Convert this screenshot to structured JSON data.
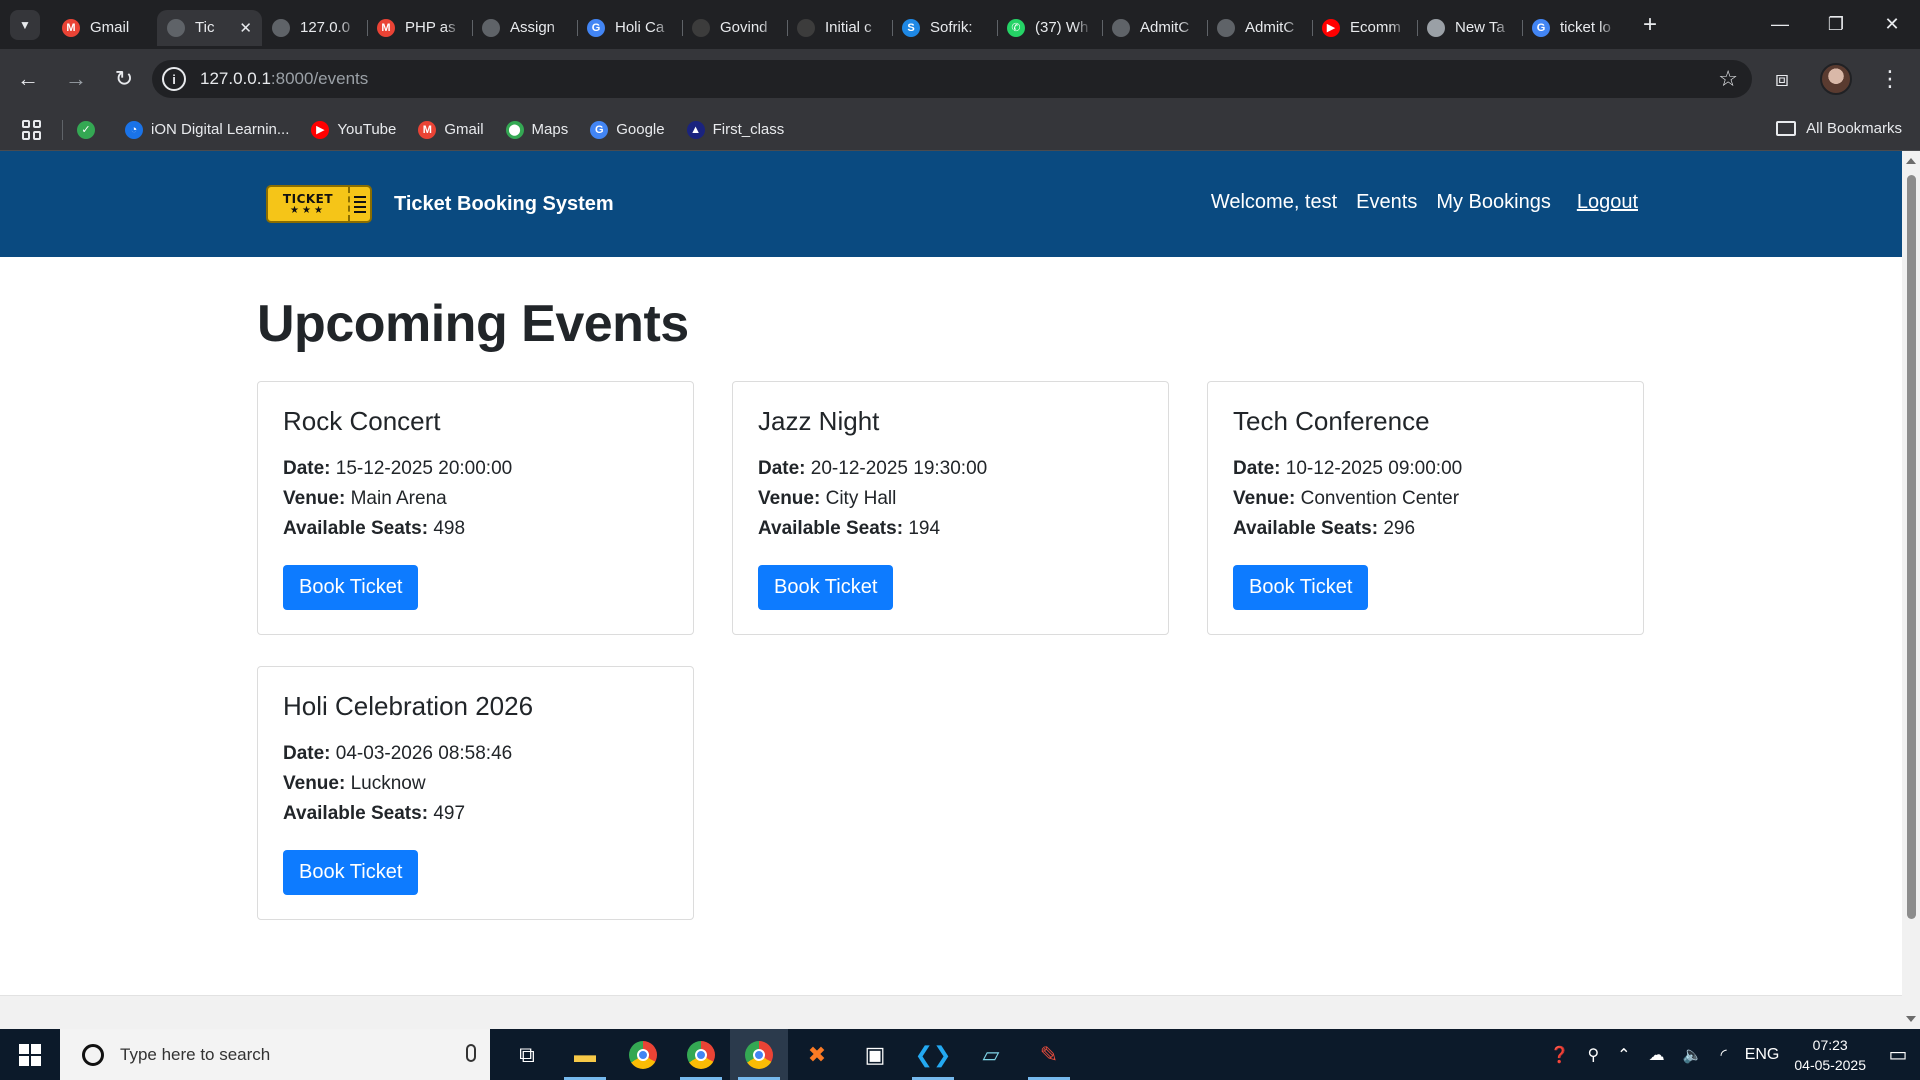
{
  "browser": {
    "tabs": [
      {
        "title": "Gmail",
        "icon": "gmail-icon",
        "color": "#ea4335",
        "glyph": "M",
        "active": false
      },
      {
        "title": "Tic",
        "icon": "globe-icon",
        "color": "#5f6368",
        "glyph": "",
        "active": true
      },
      {
        "title": "127.0.0",
        "icon": "globe-icon",
        "color": "#5f6368",
        "glyph": "",
        "active": false
      },
      {
        "title": "PHP as",
        "icon": "gmail-icon",
        "color": "#ea4335",
        "glyph": "M",
        "active": false
      },
      {
        "title": "Assign",
        "icon": "globe-icon",
        "color": "#5f6368",
        "glyph": "",
        "active": false
      },
      {
        "title": "Holi Ca",
        "icon": "google-icon",
        "color": "#4285f4",
        "glyph": "G",
        "active": false
      },
      {
        "title": "Govind",
        "icon": "github-icon",
        "color": "#3c3c3c",
        "glyph": "",
        "active": false
      },
      {
        "title": "Initial c",
        "icon": "github-icon",
        "color": "#3c3c3c",
        "glyph": "",
        "active": false
      },
      {
        "title": "Sofrik:",
        "icon": "sofrik-icon",
        "color": "#1e88e5",
        "glyph": "S",
        "active": false
      },
      {
        "title": "(37) Wh",
        "icon": "whatsapp-icon",
        "color": "#25d366",
        "glyph": "✆",
        "active": false
      },
      {
        "title": "AdmitC",
        "icon": "globe-icon",
        "color": "#5f6368",
        "glyph": "",
        "active": false
      },
      {
        "title": "AdmitC",
        "icon": "globe-icon",
        "color": "#5f6368",
        "glyph": "",
        "active": false
      },
      {
        "title": "Ecomm",
        "icon": "youtube-icon",
        "color": "#ff0000",
        "glyph": "▶",
        "active": false
      },
      {
        "title": "New Ta",
        "icon": "chrome-icon",
        "color": "#9aa0a6",
        "glyph": "",
        "active": false
      },
      {
        "title": "ticket lo",
        "icon": "google-icon",
        "color": "#4285f4",
        "glyph": "G",
        "active": false
      }
    ],
    "url_host": "127.0.0.1",
    "url_path": ":8000/events",
    "bookmarks": [
      {
        "label": "iON Digital Learnin...",
        "color": "#1a73e8",
        "glyph": "◔"
      },
      {
        "label": "YouTube",
        "color": "#ff0000",
        "glyph": "▶"
      },
      {
        "label": "Gmail",
        "color": "#ea4335",
        "glyph": "M"
      },
      {
        "label": "Maps",
        "color": "#34a853",
        "glyph": "⬤"
      },
      {
        "label": "Google",
        "color": "#4285f4",
        "glyph": "G"
      },
      {
        "label": "First_class",
        "color": "#1a237e",
        "glyph": "▲"
      }
    ],
    "all_bookmarks": "All Bookmarks"
  },
  "site": {
    "logo_text": "TICKET",
    "logo_stars": "★★★",
    "brand": "Ticket Booking System",
    "nav": {
      "welcome": "Welcome, test",
      "events": "Events",
      "my_bookings": "My Bookings",
      "logout": "Logout"
    },
    "page_title": "Upcoming Events",
    "labels": {
      "date": "Date:",
      "venue": "Venue:",
      "seats": "Available Seats:",
      "book": "Book Ticket"
    },
    "events": [
      {
        "name": "Rock Concert",
        "date": "15-12-2025 20:00:00",
        "venue": "Main Arena",
        "seats": "498"
      },
      {
        "name": "Jazz Night",
        "date": "20-12-2025 19:30:00",
        "venue": "City Hall",
        "seats": "194"
      },
      {
        "name": "Tech Conference",
        "date": "10-12-2025 09:00:00",
        "venue": "Convention Center",
        "seats": "296"
      },
      {
        "name": "Holi Celebration 2026",
        "date": "04-03-2026 08:58:46",
        "venue": "Lucknow",
        "seats": "497"
      }
    ],
    "colors": {
      "header": "#0a4a80",
      "button": "#0d7bff"
    }
  },
  "taskbar": {
    "search_placeholder": "Type here to search",
    "apps": [
      {
        "name": "task-view-icon",
        "glyph": "⧉",
        "color": "#ffffff",
        "open": false
      },
      {
        "name": "file-explorer-icon",
        "glyph": "▬",
        "color": "#f7c948",
        "open": true
      },
      {
        "name": "chrome-icon",
        "glyph": "",
        "color": "#4285f4",
        "open": false
      },
      {
        "name": "chrome-profile-icon",
        "glyph": "",
        "color": "#34a853",
        "open": true
      },
      {
        "name": "chrome-active-icon",
        "glyph": "",
        "color": "#ea4335",
        "open": true,
        "active": true
      },
      {
        "name": "xampp-icon",
        "glyph": "✖",
        "color": "#fb7a24",
        "open": false
      },
      {
        "name": "terminal-icon",
        "glyph": "▣",
        "color": "#ffffff",
        "open": false
      },
      {
        "name": "vscode-icon",
        "glyph": "❮❯",
        "color": "#23a9f2",
        "open": true
      },
      {
        "name": "notepad-icon",
        "glyph": "▱",
        "color": "#7fd3e6",
        "open": false
      },
      {
        "name": "paint-icon",
        "glyph": "✎",
        "color": "#e74c3c",
        "open": true
      }
    ],
    "language": "ENG",
    "time": "07:23",
    "date": "04-05-2025"
  }
}
